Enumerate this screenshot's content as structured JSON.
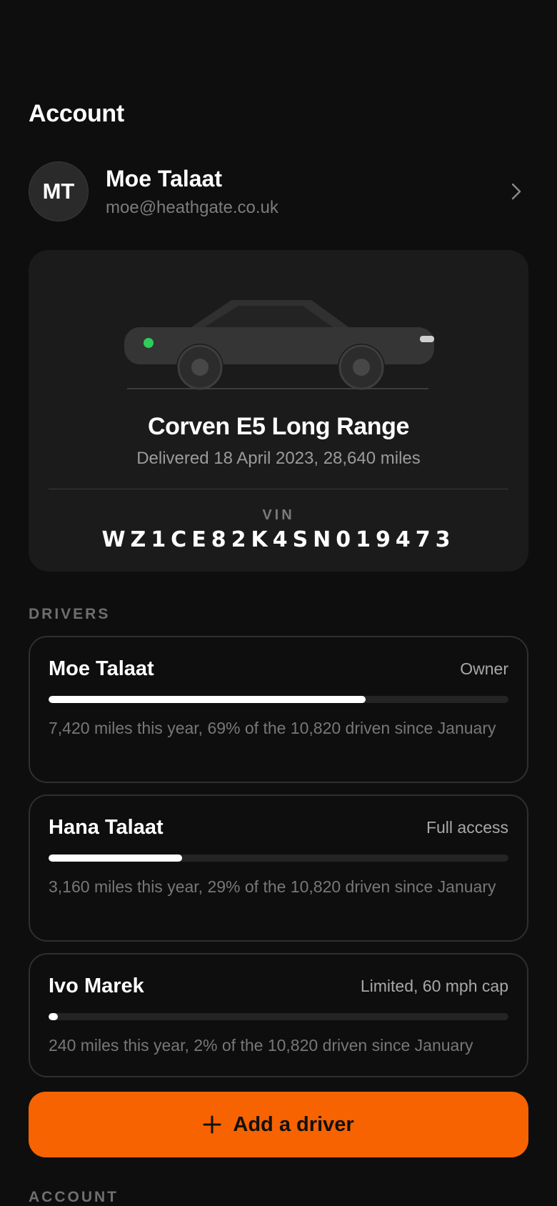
{
  "header": {
    "title": "Account"
  },
  "profile": {
    "initials": "MT",
    "name": "Moe Talaat",
    "email": "moe@heathgate.co.uk",
    "chevron_icon": "chevron-right-icon"
  },
  "vehicle": {
    "name": "Corven E5 Long Range",
    "subtitle": "Delivered 18 April 2023, 28,640 miles",
    "vin_label": "VIN",
    "vin": "WZ1CE82K4SN019473",
    "status_color": "#2ecc5a"
  },
  "drivers_section": {
    "label": "DRIVERS",
    "drivers": [
      {
        "name": "Moe Talaat",
        "role": "Owner",
        "share": 0.69,
        "note": "7,420 miles this year, 69% of the 10,820 driven since January"
      },
      {
        "name": "Hana Talaat",
        "role": "Full access",
        "share": 0.29,
        "note": "3,160 miles this year, 29% of the 10,820 driven since January"
      },
      {
        "name": "Ivo Marek",
        "role": "Limited, 60 mph cap",
        "share": 0.02,
        "note": "240 miles this year, 2% of the 10,820 driven since January"
      }
    ]
  },
  "add_driver": {
    "label": "Add a driver",
    "icon": "plus-icon",
    "color": "#f66300"
  },
  "account_section": {
    "label": "ACCOUNT"
  },
  "colors": {
    "background": "#0e0e0e",
    "card": "#1b1b1b",
    "accent": "#f66300"
  }
}
